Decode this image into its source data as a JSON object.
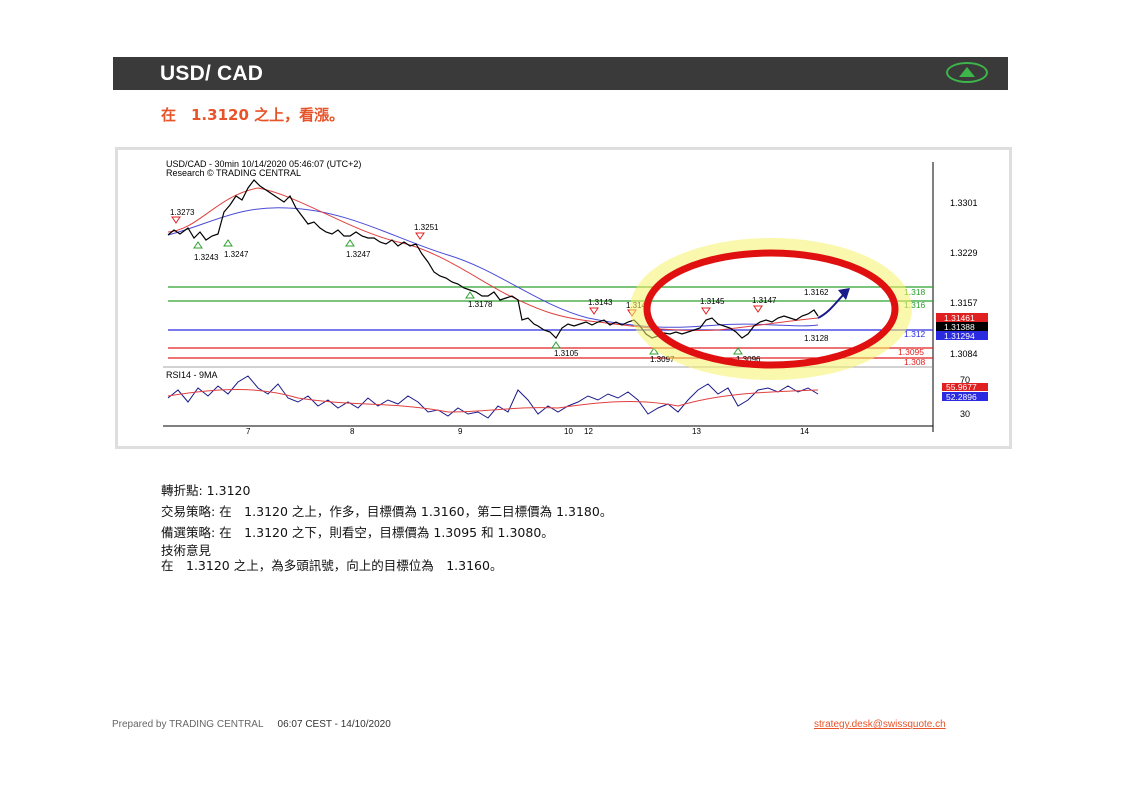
{
  "header": {
    "title": "USD/ CAD",
    "trend": "up-arrow-icon"
  },
  "headline": "在　1.3120 之上，看漲。",
  "chart": {
    "info_line": "USD/CAD - 30min 10/14/2020 05:46:07 (UTC+2)",
    "source_line": "Research © TRADING CENTRAL",
    "rsi_label": "RSI14 - 9MA",
    "price_axis": [
      "1.3301",
      "1.3229",
      "1.3157",
      "1.3084"
    ],
    "rsi_axis": [
      "70",
      "30"
    ],
    "date_ticks": [
      "7",
      "8",
      "9",
      "10",
      "12",
      "13",
      "14"
    ],
    "point_labels": [
      "1.3273",
      "1.3243",
      "1.3247",
      "1.3247",
      "1.3251",
      "1.3178",
      "1.3105",
      "1.3143",
      "1.3140",
      "1.3097",
      "1.3145",
      "1.3147",
      "1.3096",
      "1.3162",
      "1.3128"
    ],
    "level_tags": [
      "1.318",
      "1.316",
      "1.312",
      "1.3095",
      "1.308"
    ],
    "price_tags": [
      "1.31461",
      "1.31388",
      "1.31294"
    ],
    "rsi_tags": [
      "55.9677",
      "52.2896"
    ],
    "colors": {
      "support": "#e02020",
      "resistance": "#2ca02c",
      "pivot": "#2a2ae0",
      "highlight": "#e8542a"
    },
    "chart_data": {
      "type": "line",
      "series": [
        {
          "values": [
            1.3255,
            1.3262,
            1.325,
            1.329,
            1.3325,
            1.3305,
            1.3285,
            1.327,
            1.3255,
            1.325,
            1.324,
            1.3225,
            1.319,
            1.3178,
            1.316,
            1.311,
            1.3115,
            1.3125,
            1.313,
            1.314,
            1.3125,
            1.3115,
            1.31,
            1.3105,
            1.3115,
            1.313,
            1.314,
            1.312,
            1.31,
            1.3125,
            1.3135,
            1.314,
            1.3135,
            1.3146
          ]
        }
      ]
    }
  },
  "analysis": {
    "pivot": "轉折點: 1.3120",
    "strategy": "交易策略: 在　1.3120 之上，作多，目標價為 1.3160，第二目標價為 1.3180。",
    "alternative": "備選策略: 在　1.3120 之下，則看空，目標價為 1.3095 和 1.3080。",
    "comment_title": "技術意見",
    "comment": "在　1.3120 之上，為多頭訊號，向上的目標位為　1.3160。"
  },
  "footer": {
    "prepared": "Prepared by TRADING CENTRAL",
    "timestamp": "06:07 CEST - 14/10/2020",
    "email": "strategy.desk@swissquote.ch"
  }
}
